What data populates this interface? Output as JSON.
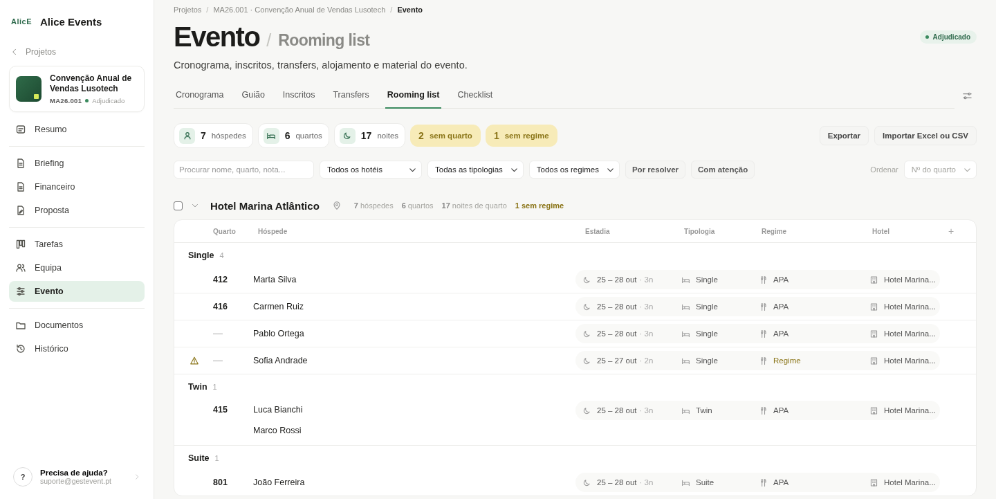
{
  "sidebar": {
    "logo_text": "AlicE",
    "app_name": "Alice Events",
    "back_link": "Projetos",
    "project": {
      "name": "Convenção Anual de Vendas Lusotech",
      "code": "MA26.001",
      "status": "Adjudicado"
    },
    "nav_groups": [
      [
        {
          "label": "Resumo",
          "selected": false
        }
      ],
      [
        {
          "label": "Briefing",
          "selected": false
        },
        {
          "label": "Financeiro",
          "selected": false
        },
        {
          "label": "Proposta",
          "selected": false
        }
      ],
      [
        {
          "label": "Tarefas",
          "selected": false
        },
        {
          "label": "Equipa",
          "selected": false
        },
        {
          "label": "Evento",
          "selected": true
        }
      ],
      [
        {
          "label": "Documentos",
          "selected": false
        },
        {
          "label": "Histórico",
          "selected": false
        }
      ]
    ],
    "help": {
      "icon_text": "?",
      "title": "Precisa de ajuda?",
      "email": "suporte@gestevent.pt"
    }
  },
  "header": {
    "breadcrumb": [
      "Projetos",
      "MA26.001 · Convenção Anual de Vendas Lusotech",
      "Evento"
    ],
    "separator": "/",
    "title": "Evento",
    "subtitle": "Rooming list",
    "status": "Adjudicado",
    "description": "Cronograma, inscritos, transfers, alojamento e material do evento."
  },
  "tabs": [
    {
      "label": "Cronograma",
      "selected": false
    },
    {
      "label": "Guião",
      "selected": false
    },
    {
      "label": "Inscritos",
      "selected": false
    },
    {
      "label": "Transfers",
      "selected": false
    },
    {
      "label": "Rooming list",
      "selected": true
    },
    {
      "label": "Checklist",
      "selected": false
    }
  ],
  "stats": [
    {
      "kind": "count",
      "value": "7",
      "label": "hóspedes"
    },
    {
      "kind": "count",
      "value": "6",
      "label": "quartos"
    },
    {
      "kind": "count",
      "value": "17",
      "label": "noites"
    },
    {
      "kind": "warning",
      "value": "2",
      "label": "sem quarto"
    },
    {
      "kind": "warning",
      "value": "1",
      "label": "sem regime"
    }
  ],
  "actions": [
    "Exportar",
    "Importar Excel ou CSV"
  ],
  "filters": {
    "search_placeholder": "Procurar nome, quarto, nota...",
    "selects": [
      "Todos os hotéis",
      "Todas as tipologias",
      "Todos os regimes"
    ],
    "toggles": [
      "Por resolver",
      "Com atenção"
    ],
    "sort_label": "Ordenar",
    "sort_value": "Nº do quarto"
  },
  "hotel_group": {
    "checked": false,
    "expanded": true,
    "name": "Hotel Marina Atlântico",
    "stats": [
      {
        "kind": "count",
        "text": "**7** hóspedes"
      },
      {
        "kind": "count",
        "text": "**6** quartos"
      },
      {
        "kind": "count",
        "text": "**17** noites de quarto"
      },
      {
        "kind": "warning",
        "text": "1 sem regime"
      }
    ],
    "columns": [
      "Quarto",
      "Hóspede",
      "Estadia",
      "Tipologia",
      "Regime",
      "Hotel"
    ],
    "add_column": "+",
    "sections": [
      {
        "name": "Single",
        "count": "4",
        "rows": [
          {
            "warning": false,
            "room": "412",
            "guests": [
              "Marta Silva"
            ],
            "stay": "25 – 28 out",
            "nights": "· 3n",
            "typology": "Single",
            "regime": "APA",
            "regime_missing": false,
            "hotel": "Hotel Marina..."
          },
          {
            "warning": false,
            "room": "416",
            "guests": [
              "Carmen Ruiz"
            ],
            "stay": "25 – 28 out",
            "nights": "· 3n",
            "typology": "Single",
            "regime": "APA",
            "regime_missing": false,
            "hotel": "Hotel Marina..."
          },
          {
            "warning": false,
            "room": "––",
            "guests": [
              "Pablo Ortega"
            ],
            "stay": "25 – 28 out",
            "nights": "· 3n",
            "typology": "Single",
            "regime": "APA",
            "regime_missing": false,
            "hotel": "Hotel Marina..."
          },
          {
            "warning": true,
            "room": "––",
            "guests": [
              "Sofia Andrade"
            ],
            "stay": "25 – 27 out",
            "nights": "· 2n",
            "typology": "Single",
            "regime": "Regime",
            "regime_missing": true,
            "hotel": "Hotel Marina..."
          }
        ]
      },
      {
        "name": "Twin",
        "count": "1",
        "rows": [
          {
            "warning": false,
            "room": "415",
            "guests": [
              "Luca Bianchi",
              "Marco Rossi"
            ],
            "stay": "25 – 28 out",
            "nights": "· 3n",
            "typology": "Twin",
            "regime": "APA",
            "regime_missing": false,
            "hotel": "Hotel Marina..."
          }
        ]
      },
      {
        "name": "Suite",
        "count": "1",
        "rows": [
          {
            "warning": false,
            "room": "801",
            "guests": [
              "João Ferreira"
            ],
            "stay": "25 – 28 out",
            "nights": "· 3n",
            "typology": "Suite",
            "regime": "APA",
            "regime_missing": false,
            "hotel": "Hotel Marina..."
          }
        ]
      }
    ]
  }
}
